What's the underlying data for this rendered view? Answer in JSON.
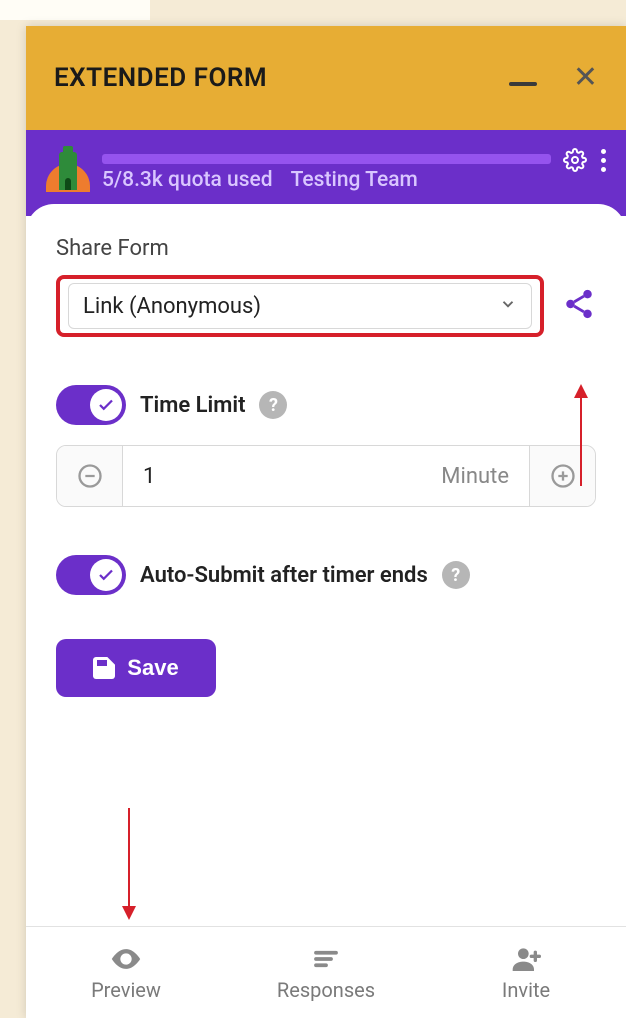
{
  "titlebar": {
    "title": "EXTENDED FORM"
  },
  "header": {
    "quota": "5/8.3k quota used",
    "team": "Testing Team"
  },
  "share": {
    "label": "Share Form",
    "selected": "Link (Anonymous)"
  },
  "timeLimit": {
    "label": "Time Limit",
    "value": "1",
    "unit": "Minute"
  },
  "autoSubmit": {
    "label": "Auto-Submit after timer ends"
  },
  "save": {
    "label": "Save"
  },
  "nav": {
    "preview": "Preview",
    "responses": "Responses",
    "invite": "Invite"
  },
  "colors": {
    "accent": "#6b2fc9",
    "titlebar": "#e7ad34",
    "annotation": "#d6202a"
  }
}
